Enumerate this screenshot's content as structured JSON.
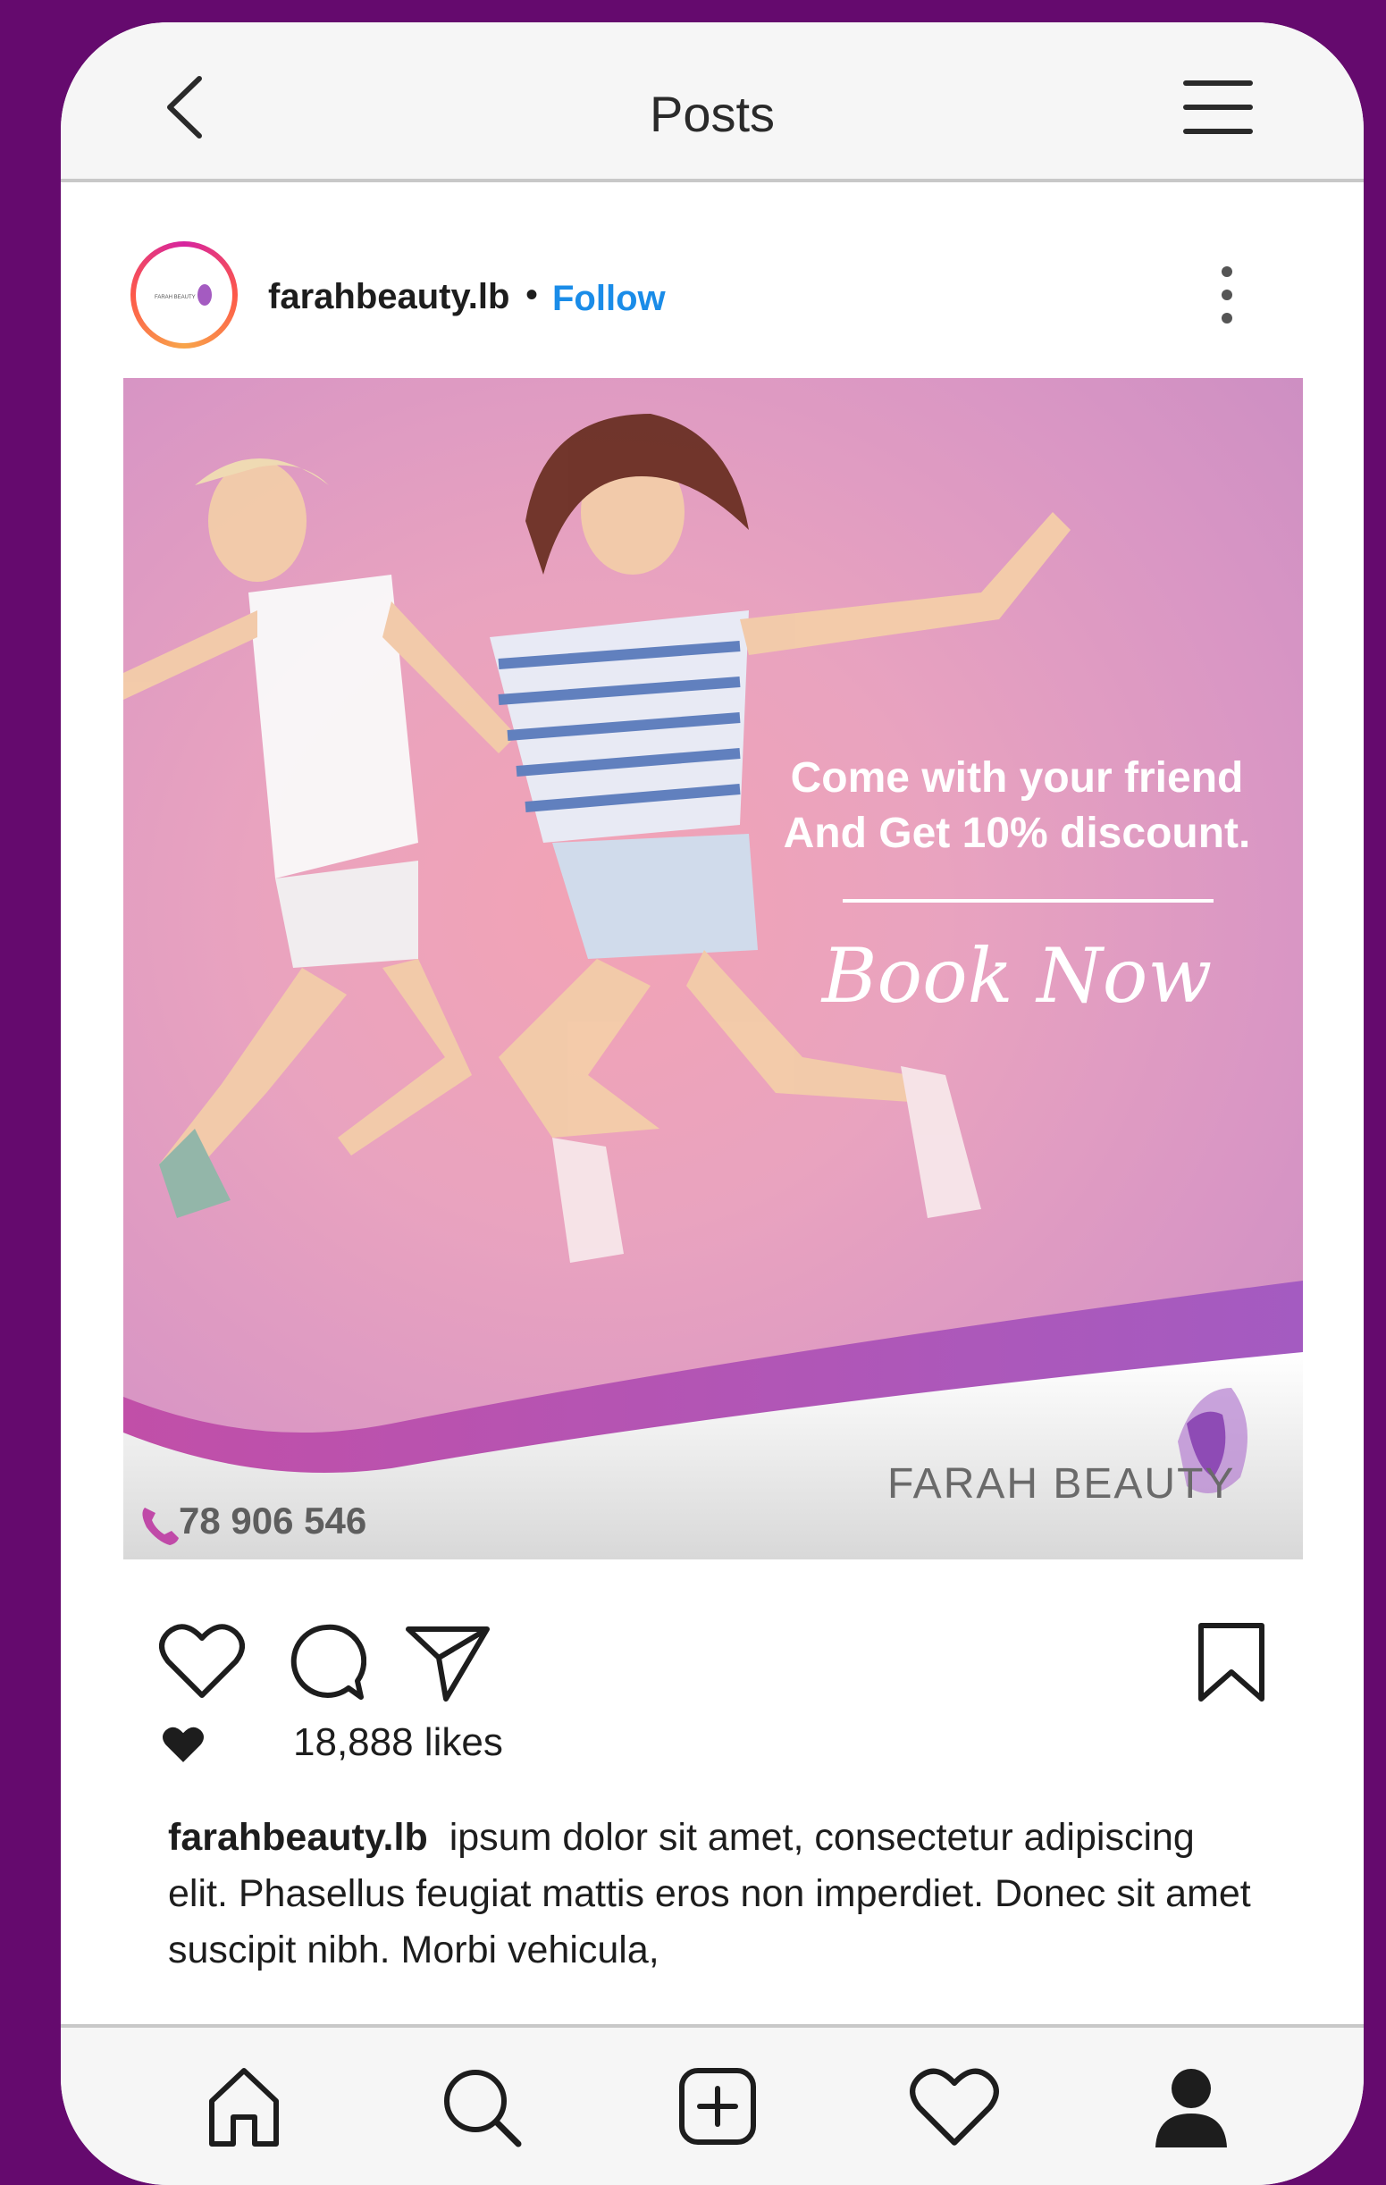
{
  "header": {
    "title": "Posts"
  },
  "post": {
    "username": "farahbeauty.lb",
    "separator": "•",
    "follow_label": "Follow",
    "avatar_logo_text": "FARAH BEAUTY",
    "image": {
      "promo_line1": "Come with your friend",
      "promo_line2": "And Get 10% discount.",
      "cta": "Book Now",
      "brand_name": "FARAH BEAUTY",
      "phone_number": "78 906 546"
    },
    "likes_label": "18,888 likes",
    "caption_user": "farahbeauty.lb",
    "caption_text": "ipsum dolor sit amet, consectetur adipiscing elit. Phasellus feugiat mattis eros non imperdiet. Donec sit amet suscipit nibh. Morbi vehicula,"
  },
  "icons": {
    "back": "chevron-left-icon",
    "menu": "hamburger-menu-icon",
    "more": "more-vertical-icon",
    "like": "heart-outline-icon",
    "comment": "comment-bubble-icon",
    "share": "paper-plane-icon",
    "save": "bookmark-icon",
    "likes_heart": "heart-filled-icon",
    "nav": [
      "home-icon",
      "search-icon",
      "add-post-icon",
      "activity-heart-icon",
      "profile-icon"
    ]
  },
  "colors": {
    "background": "#650a6e",
    "follow": "#1a8ce8",
    "brand_purple": "#a45bc1",
    "image_pink": "#e9a3bf"
  }
}
